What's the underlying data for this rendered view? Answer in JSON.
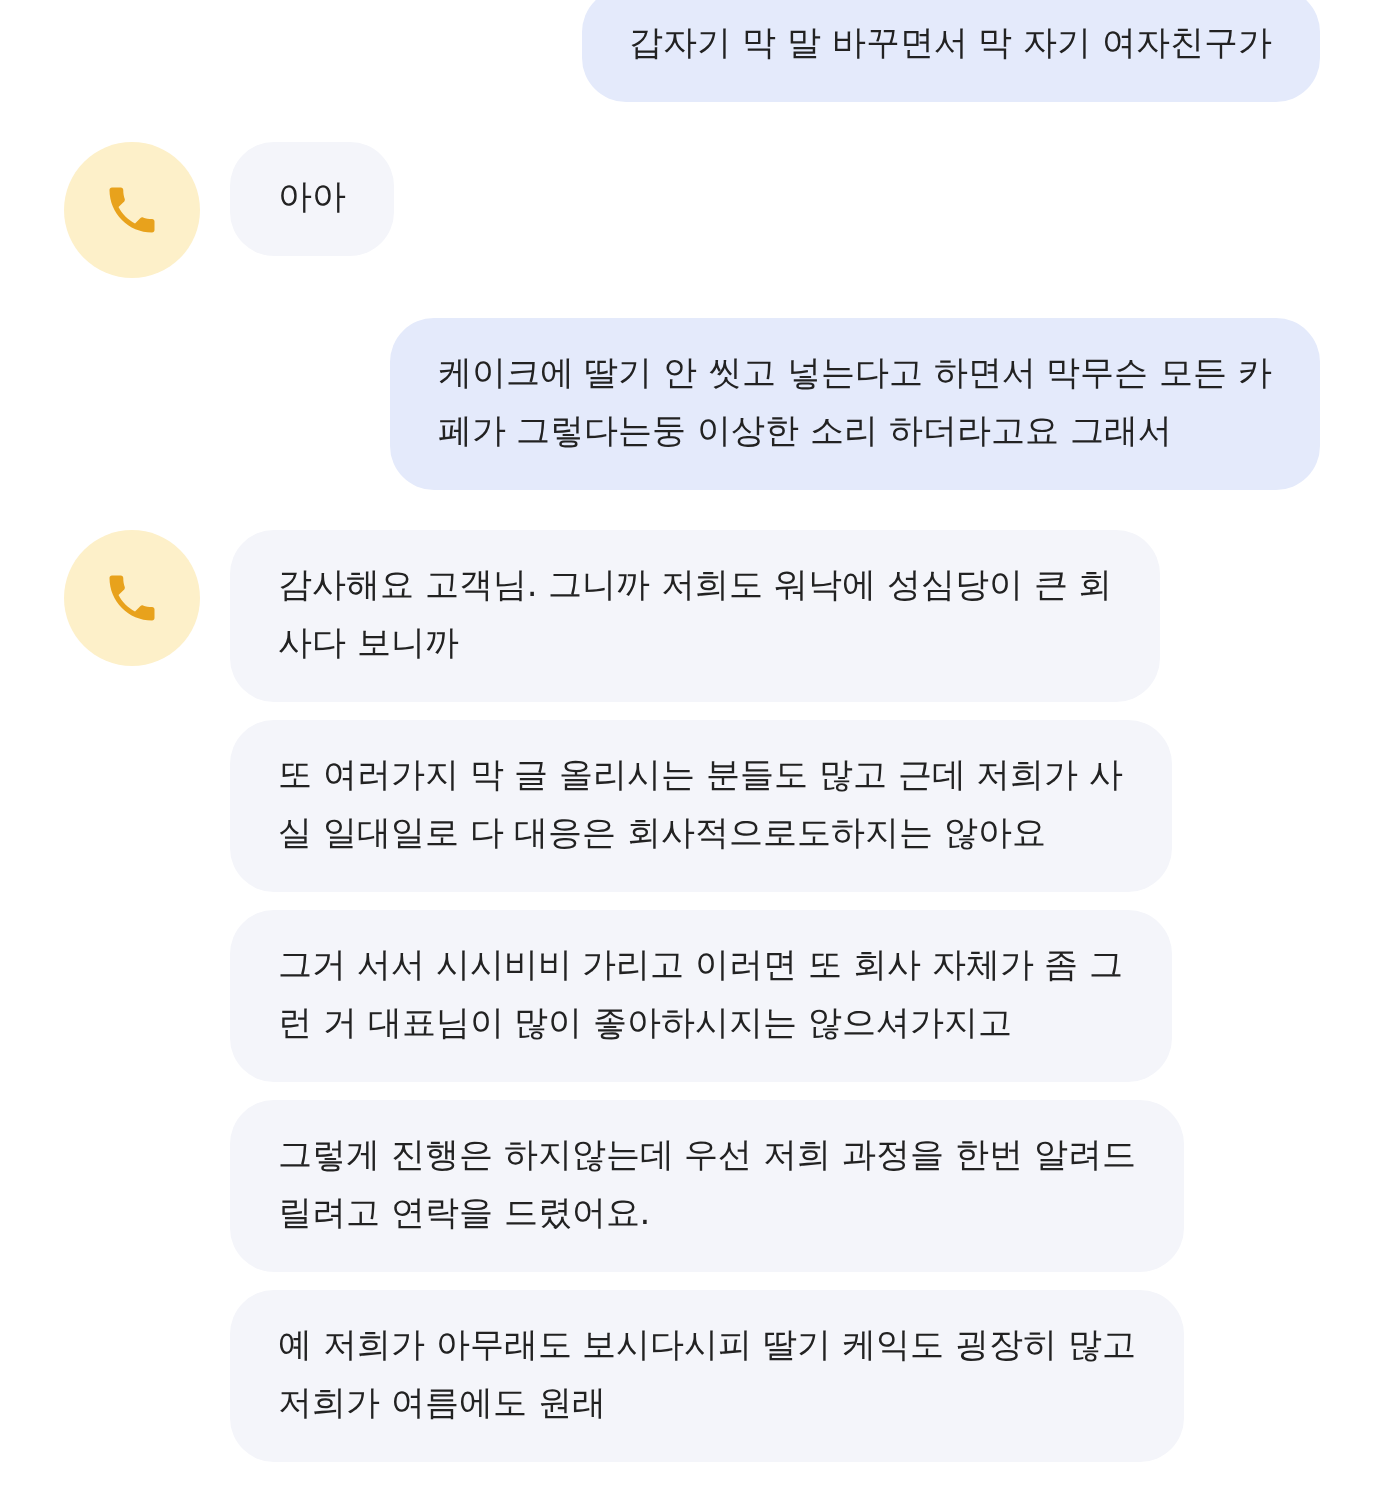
{
  "messages": [
    {
      "kind": "outgoing",
      "avatar": false,
      "lines": [
        "갑자기 막 말 바꾸면서 막 자기 여자친구가"
      ]
    },
    {
      "kind": "incoming",
      "avatar": true,
      "lines": [
        "아아"
      ]
    },
    {
      "kind": "outgoing",
      "avatar": false,
      "lines": [
        "케이크에 딸기 안 씻고 넣는다고 하면서 막무슨 모든 카",
        "페가 그렇다는둥 이상한 소리 하더라고요 그래서"
      ]
    },
    {
      "kind": "incoming",
      "avatar": true,
      "lines": [
        "감사해요 고객님. 그니까 저희도 워낙에 성심당이 큰 회",
        "사다 보니까"
      ]
    },
    {
      "kind": "incoming",
      "avatar": false,
      "lines": [
        "또 여러가지 막 글 올리시는 분들도 많고 근데 저희가 사",
        "실 일대일로 다 대응은 회사적으로도하지는 않아요"
      ]
    },
    {
      "kind": "incoming",
      "avatar": false,
      "lines": [
        "그거 서서 시시비비 가리고 이러면 또 회사 자체가 좀 그",
        "런 거 대표님이 많이 좋아하시지는 않으셔가지고"
      ]
    },
    {
      "kind": "incoming",
      "avatar": false,
      "lines": [
        "그렇게 진행은 하지않는데 우선 저희 과정을 한번 알려드",
        "릴려고 연락을 드렸어요."
      ]
    },
    {
      "kind": "incoming",
      "avatar": false,
      "lines": [
        "예 저희가 아무래도 보시다시피 딸기 케익도 굉장히 많고",
        "저희가 여름에도 원래"
      ]
    }
  ]
}
